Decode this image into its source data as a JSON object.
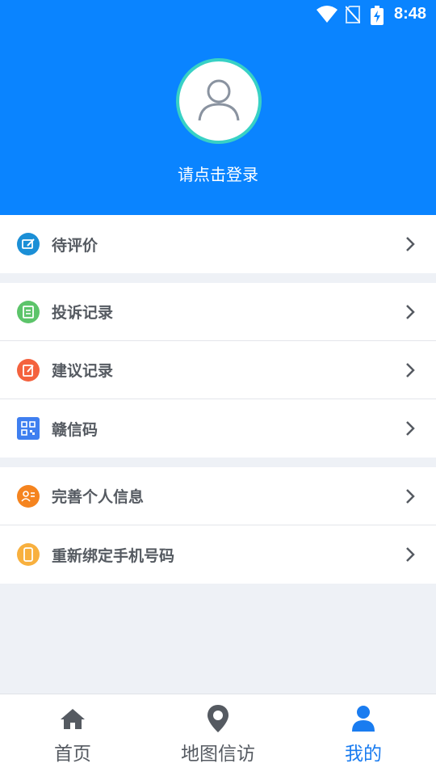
{
  "status_bar": {
    "time": "8:48",
    "icons": [
      "wifi-icon",
      "no-sim-icon",
      "battery-charging-icon"
    ]
  },
  "profile": {
    "avatar_icon": "user-placeholder-icon",
    "login_prompt": "请点击登录"
  },
  "menu": {
    "group1": [
      {
        "label": "待评价",
        "icon": "evaluate-icon",
        "color": "#1b8fd6"
      }
    ],
    "group2": [
      {
        "label": "投诉记录",
        "icon": "complaint-record-icon",
        "color": "#5cc46a"
      },
      {
        "label": "建议记录",
        "icon": "suggestion-record-icon",
        "color": "#f4623e"
      },
      {
        "label": "赣信码",
        "icon": "qr-code-icon",
        "color": "#3f7ff0"
      }
    ],
    "group3": [
      {
        "label": "完善个人信息",
        "icon": "personal-info-icon",
        "color": "#f5841f"
      },
      {
        "label": "重新绑定手机号码",
        "icon": "rebind-phone-icon",
        "color": "#f8b03e"
      }
    ]
  },
  "tabbar": {
    "tabs": [
      {
        "label": "首页",
        "icon": "home-icon",
        "active": false
      },
      {
        "label": "地图信访",
        "icon": "map-pin-icon",
        "active": false
      },
      {
        "label": "我的",
        "icon": "profile-icon",
        "active": true
      }
    ]
  },
  "colors": {
    "header_bg": "#0a84ff",
    "avatar_ring": "#38d1c5",
    "active_tab": "#1a7cf0"
  }
}
